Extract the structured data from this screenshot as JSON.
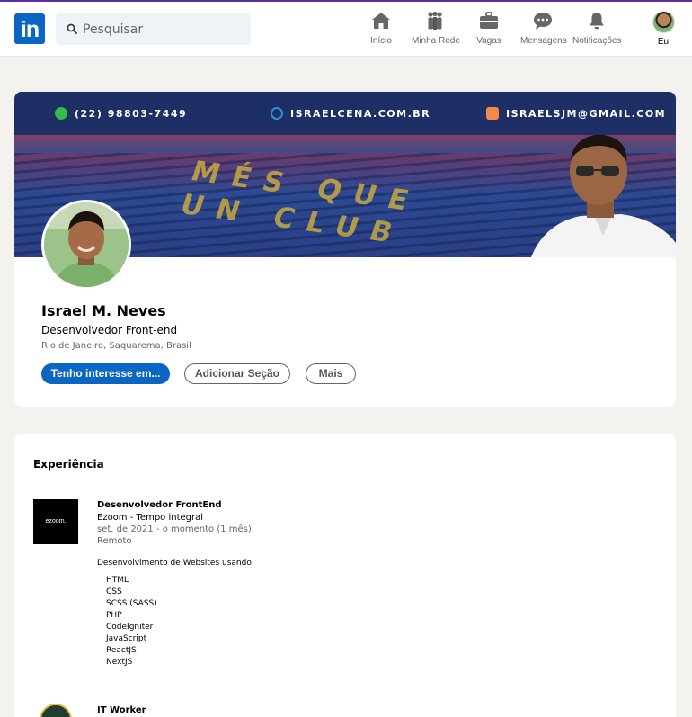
{
  "nav": {
    "logo": "in",
    "search_placeholder": "Pesquisar",
    "items": [
      {
        "label": "Início",
        "icon": "home-icon"
      },
      {
        "label": "Minha Rede",
        "icon": "network-icon"
      },
      {
        "label": "Vagas",
        "icon": "briefcase-icon"
      },
      {
        "label": "Mensagens",
        "icon": "messages-icon"
      },
      {
        "label": "Notificações",
        "icon": "bell-icon"
      }
    ],
    "me_label": "Eu"
  },
  "banner": {
    "phone": "(22) 98803-7449",
    "website": "ISRAELCENA.COM.BR",
    "email": "ISRAELSJM@GMAIL.COM",
    "slogan": "MÉS QUE UN CLUB"
  },
  "profile": {
    "name": "Israel M. Neves",
    "headline": "Desenvolvedor Front-end",
    "location": "Rio de Janeiro, Saquarema, Brasil",
    "buttons": {
      "interest": "Tenho interesse em...",
      "add_section": "Adicionar Seção",
      "more": "Mais"
    }
  },
  "experience": {
    "title": "Experiência",
    "jobs": [
      {
        "logo_text": "ezoom.",
        "title": "Desenvolvedor FrontEnd",
        "company": "Ezoom - Tempo integral",
        "period": "set. de 2021 - o momento (1 mês)",
        "mode": "Remoto",
        "description": "Desenvolvimento de Websites usando",
        "skills": [
          "HTML",
          "CSS",
          "SCSS (SASS)",
          "PHP",
          "CodeIgniter",
          "JavaScript",
          "ReactJS",
          "NextJS"
        ]
      },
      {
        "title": "IT Worker"
      }
    ]
  },
  "colors": {
    "brand": "#0a66c2",
    "top_accent": "#5b2da3",
    "background": "#f3f2ef"
  }
}
